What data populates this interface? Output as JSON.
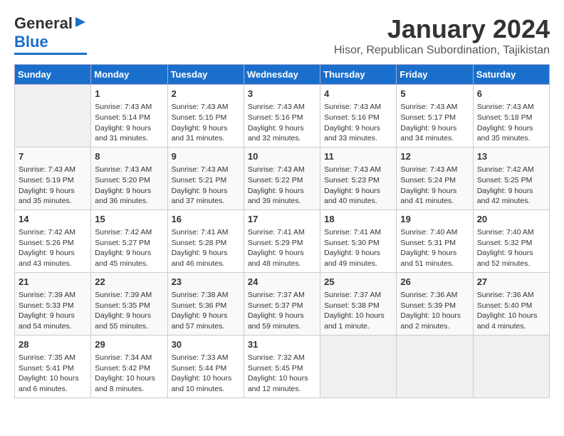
{
  "header": {
    "logo_general": "General",
    "logo_blue": "Blue",
    "title": "January 2024",
    "subtitle": "Hisor, Republican Subordination, Tajikistan"
  },
  "days_of_week": [
    "Sunday",
    "Monday",
    "Tuesday",
    "Wednesday",
    "Thursday",
    "Friday",
    "Saturday"
  ],
  "weeks": [
    [
      {
        "day": "",
        "info": ""
      },
      {
        "day": "1",
        "info": "Sunrise: 7:43 AM\nSunset: 5:14 PM\nDaylight: 9 hours\nand 31 minutes."
      },
      {
        "day": "2",
        "info": "Sunrise: 7:43 AM\nSunset: 5:15 PM\nDaylight: 9 hours\nand 31 minutes."
      },
      {
        "day": "3",
        "info": "Sunrise: 7:43 AM\nSunset: 5:16 PM\nDaylight: 9 hours\nand 32 minutes."
      },
      {
        "day": "4",
        "info": "Sunrise: 7:43 AM\nSunset: 5:16 PM\nDaylight: 9 hours\nand 33 minutes."
      },
      {
        "day": "5",
        "info": "Sunrise: 7:43 AM\nSunset: 5:17 PM\nDaylight: 9 hours\nand 34 minutes."
      },
      {
        "day": "6",
        "info": "Sunrise: 7:43 AM\nSunset: 5:18 PM\nDaylight: 9 hours\nand 35 minutes."
      }
    ],
    [
      {
        "day": "7",
        "info": "Sunrise: 7:43 AM\nSunset: 5:19 PM\nDaylight: 9 hours\nand 35 minutes."
      },
      {
        "day": "8",
        "info": "Sunrise: 7:43 AM\nSunset: 5:20 PM\nDaylight: 9 hours\nand 36 minutes."
      },
      {
        "day": "9",
        "info": "Sunrise: 7:43 AM\nSunset: 5:21 PM\nDaylight: 9 hours\nand 37 minutes."
      },
      {
        "day": "10",
        "info": "Sunrise: 7:43 AM\nSunset: 5:22 PM\nDaylight: 9 hours\nand 39 minutes."
      },
      {
        "day": "11",
        "info": "Sunrise: 7:43 AM\nSunset: 5:23 PM\nDaylight: 9 hours\nand 40 minutes."
      },
      {
        "day": "12",
        "info": "Sunrise: 7:43 AM\nSunset: 5:24 PM\nDaylight: 9 hours\nand 41 minutes."
      },
      {
        "day": "13",
        "info": "Sunrise: 7:42 AM\nSunset: 5:25 PM\nDaylight: 9 hours\nand 42 minutes."
      }
    ],
    [
      {
        "day": "14",
        "info": "Sunrise: 7:42 AM\nSunset: 5:26 PM\nDaylight: 9 hours\nand 43 minutes."
      },
      {
        "day": "15",
        "info": "Sunrise: 7:42 AM\nSunset: 5:27 PM\nDaylight: 9 hours\nand 45 minutes."
      },
      {
        "day": "16",
        "info": "Sunrise: 7:41 AM\nSunset: 5:28 PM\nDaylight: 9 hours\nand 46 minutes."
      },
      {
        "day": "17",
        "info": "Sunrise: 7:41 AM\nSunset: 5:29 PM\nDaylight: 9 hours\nand 48 minutes."
      },
      {
        "day": "18",
        "info": "Sunrise: 7:41 AM\nSunset: 5:30 PM\nDaylight: 9 hours\nand 49 minutes."
      },
      {
        "day": "19",
        "info": "Sunrise: 7:40 AM\nSunset: 5:31 PM\nDaylight: 9 hours\nand 51 minutes."
      },
      {
        "day": "20",
        "info": "Sunrise: 7:40 AM\nSunset: 5:32 PM\nDaylight: 9 hours\nand 52 minutes."
      }
    ],
    [
      {
        "day": "21",
        "info": "Sunrise: 7:39 AM\nSunset: 5:33 PM\nDaylight: 9 hours\nand 54 minutes."
      },
      {
        "day": "22",
        "info": "Sunrise: 7:39 AM\nSunset: 5:35 PM\nDaylight: 9 hours\nand 55 minutes."
      },
      {
        "day": "23",
        "info": "Sunrise: 7:38 AM\nSunset: 5:36 PM\nDaylight: 9 hours\nand 57 minutes."
      },
      {
        "day": "24",
        "info": "Sunrise: 7:37 AM\nSunset: 5:37 PM\nDaylight: 9 hours\nand 59 minutes."
      },
      {
        "day": "25",
        "info": "Sunrise: 7:37 AM\nSunset: 5:38 PM\nDaylight: 10 hours\nand 1 minute."
      },
      {
        "day": "26",
        "info": "Sunrise: 7:36 AM\nSunset: 5:39 PM\nDaylight: 10 hours\nand 2 minutes."
      },
      {
        "day": "27",
        "info": "Sunrise: 7:36 AM\nSunset: 5:40 PM\nDaylight: 10 hours\nand 4 minutes."
      }
    ],
    [
      {
        "day": "28",
        "info": "Sunrise: 7:35 AM\nSunset: 5:41 PM\nDaylight: 10 hours\nand 6 minutes."
      },
      {
        "day": "29",
        "info": "Sunrise: 7:34 AM\nSunset: 5:42 PM\nDaylight: 10 hours\nand 8 minutes."
      },
      {
        "day": "30",
        "info": "Sunrise: 7:33 AM\nSunset: 5:44 PM\nDaylight: 10 hours\nand 10 minutes."
      },
      {
        "day": "31",
        "info": "Sunrise: 7:32 AM\nSunset: 5:45 PM\nDaylight: 10 hours\nand 12 minutes."
      },
      {
        "day": "",
        "info": ""
      },
      {
        "day": "",
        "info": ""
      },
      {
        "day": "",
        "info": ""
      }
    ]
  ]
}
